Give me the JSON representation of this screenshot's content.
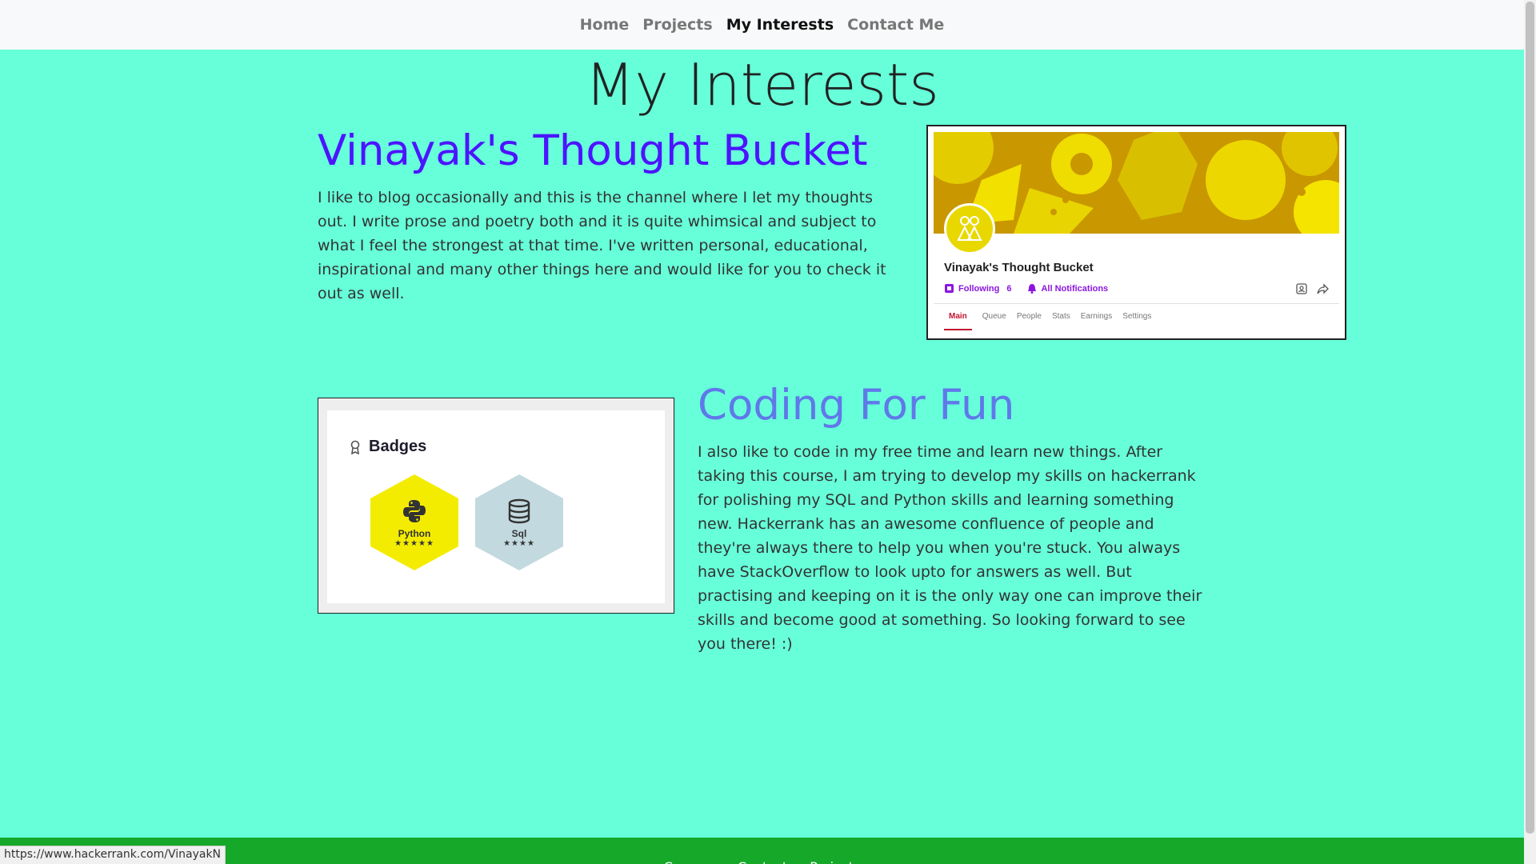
{
  "nav": {
    "items": [
      {
        "label": "Home",
        "active": false
      },
      {
        "label": "Projects",
        "active": false
      },
      {
        "label": "My Interests",
        "active": true
      },
      {
        "label": "Contact Me",
        "active": false
      }
    ]
  },
  "page": {
    "title": "My Interests"
  },
  "section_blog": {
    "title": "Vinayak's Thought Bucket",
    "text": "I like to blog occasionally and this is the channel where I let my thoughts out. I write prose and poetry both and it is quite whimsical and subject to what I feel the strongest at that time. I've written personal, educational, inspirational and many other things here and would like for you to check it out as well.",
    "card": {
      "name": "Vinayak's Thought Bucket",
      "following_label": "Following",
      "following_count": "6",
      "notifications_label": "All Notifications",
      "tabs": [
        "Main",
        "Queue",
        "People",
        "Stats",
        "Earnings",
        "Settings"
      ]
    }
  },
  "section_coding": {
    "title": "Coding For Fun",
    "text": "I also like to code in my free time and learn new things. After taking this course, I am trying to develop my skills on hackerrank for polishing my SQL and Python skills and learning something new. Hackerrank has an awesome confluence of people and they're always there to help you when you're stuck. You always have StackOverflow to look upto for answers as well. But practising and keeping on it is the only way one can improve their skills and become good at something. So looking forward to see you there! :)",
    "card": {
      "heading": "Badges",
      "badges": [
        {
          "name": "Python",
          "stars": "★★★★★",
          "color": "#f4ec00"
        },
        {
          "name": "Sql",
          "stars": "★★★★",
          "color": "#c2d9df"
        }
      ]
    }
  },
  "footer": {
    "items": [
      "Courses",
      "Contact",
      "Projects"
    ]
  },
  "status_bar": {
    "url": "https://www.hackerrank.com/VinayakN"
  },
  "colors": {
    "background": "#66ffd9",
    "blog_title": "#4c14ff",
    "coding_title": "#6078ea",
    "footer": "#16a829"
  }
}
